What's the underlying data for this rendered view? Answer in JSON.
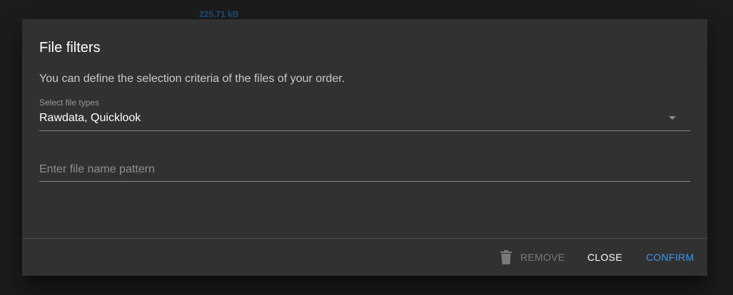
{
  "background": {
    "size_text": "225.71 kB"
  },
  "dialog": {
    "title": "File filters",
    "description": "You can define the selection criteria of the files of your order.",
    "file_types": {
      "label": "Select file types",
      "value": "Rawdata, Quicklook"
    },
    "name_pattern": {
      "placeholder": "Enter file name pattern",
      "value": ""
    },
    "actions": {
      "remove_label": "Remove",
      "close_label": "Close",
      "confirm_label": "Confirm"
    }
  },
  "colors": {
    "dialog_bg": "#313131",
    "accent": "#3d96e8",
    "disabled": "#7a7a7a"
  },
  "icons": {
    "remove": "trash-icon",
    "select": "dropdown-arrow-icon"
  }
}
